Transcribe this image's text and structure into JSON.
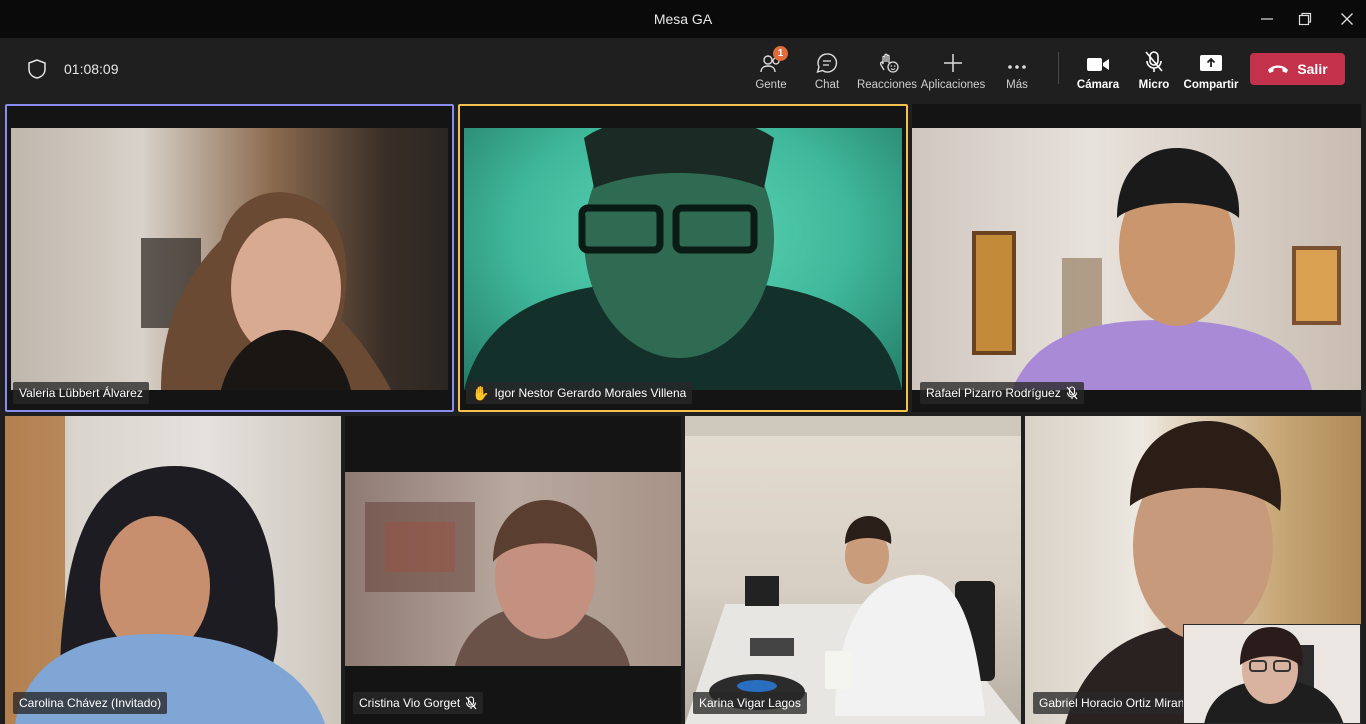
{
  "window": {
    "title": "Mesa GA"
  },
  "meeting": {
    "duration": "01:08:09"
  },
  "toolbar": {
    "people": {
      "label": "Gente",
      "badge": "1"
    },
    "chat": {
      "label": "Chat"
    },
    "reactions": {
      "label": "Reacciones"
    },
    "apps": {
      "label": "Aplicaciones"
    },
    "more": {
      "label": "Más"
    },
    "camera": {
      "label": "Cámara"
    },
    "mic": {
      "label": "Micro"
    },
    "share": {
      "label": "Compartir"
    },
    "leave": {
      "label": "Salir"
    }
  },
  "participants": [
    {
      "name": "Valeria Lübbert Álvarez",
      "muted": false,
      "hand_raised": false
    },
    {
      "name": "Igor Nestor Gerardo Morales Villena",
      "muted": false,
      "hand_raised": true
    },
    {
      "name": "Rafael Pizarro Rodríguez",
      "muted": true,
      "hand_raised": false
    },
    {
      "name": "Carolina Chávez (Invitado)",
      "muted": false,
      "hand_raised": false
    },
    {
      "name": "Cristina Vio Gorget",
      "muted": true,
      "hand_raised": false
    },
    {
      "name": "Karina Vigar Lagos",
      "muted": false,
      "hand_raised": false
    },
    {
      "name": "Gabriel Horacio Ortiz Miranda",
      "muted": false,
      "hand_raised": false
    }
  ],
  "colors": {
    "active_speaker_frame": "#8b8cf0",
    "hand_raised_frame": "#f2c14e",
    "leave_button": "#c4314b",
    "badge": "#e06c3c"
  }
}
